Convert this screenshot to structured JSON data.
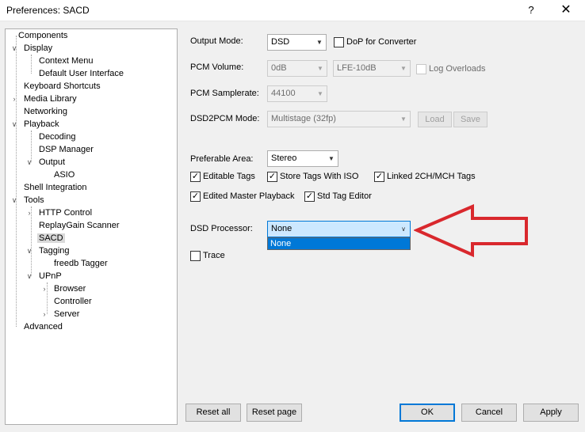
{
  "window": {
    "title": "Preferences: SACD",
    "help_label": "?",
    "close_label": "✕"
  },
  "tree": {
    "items": [
      {
        "label": "Components"
      },
      {
        "label": "Display"
      },
      {
        "label": "Context Menu"
      },
      {
        "label": "Default User Interface"
      },
      {
        "label": "Keyboard Shortcuts"
      },
      {
        "label": "Media Library"
      },
      {
        "label": "Networking"
      },
      {
        "label": "Playback"
      },
      {
        "label": "Decoding"
      },
      {
        "label": "DSP Manager"
      },
      {
        "label": "Output"
      },
      {
        "label": "ASIO"
      },
      {
        "label": "Shell Integration"
      },
      {
        "label": "Tools"
      },
      {
        "label": "HTTP Control"
      },
      {
        "label": "ReplayGain Scanner"
      },
      {
        "label": "SACD"
      },
      {
        "label": "Tagging"
      },
      {
        "label": "freedb Tagger"
      },
      {
        "label": "UPnP"
      },
      {
        "label": "Browser"
      },
      {
        "label": "Controller"
      },
      {
        "label": "Server"
      },
      {
        "label": "Advanced"
      }
    ],
    "selected": "SACD"
  },
  "settings": {
    "output_mode_label": "Output Mode:",
    "output_mode_value": "DSD",
    "dop_label": "DoP for Converter",
    "pcm_volume_label": "PCM Volume:",
    "pcm_volume_value": "0dB",
    "lfe_value": "LFE-10dB",
    "log_overloads_label": "Log Overloads",
    "pcm_samplerate_label": "PCM Samplerate:",
    "pcm_samplerate_value": "44100",
    "dsd2pcm_label": "DSD2PCM Mode:",
    "dsd2pcm_value": "Multistage (32fp)",
    "load_label": "Load",
    "save_label": "Save",
    "preferable_area_label": "Preferable Area:",
    "preferable_area_value": "Stereo",
    "editable_tags_label": "Editable Tags",
    "store_tags_label": "Store Tags With ISO",
    "linked_tags_label": "Linked 2CH/MCH Tags",
    "edited_master_label": "Edited Master Playback",
    "std_tag_editor_label": "Std Tag Editor",
    "dsd_processor_label": "DSD Processor:",
    "dsd_processor_value": "None",
    "dsd_processor_options": [
      "None"
    ],
    "trace_label": "Trace"
  },
  "buttons": {
    "reset_all": "Reset all",
    "reset_page": "Reset page",
    "ok": "OK",
    "cancel": "Cancel",
    "apply": "Apply"
  },
  "colors": {
    "annotation_arrow": "#d9282d",
    "selection": "#0078d7"
  }
}
